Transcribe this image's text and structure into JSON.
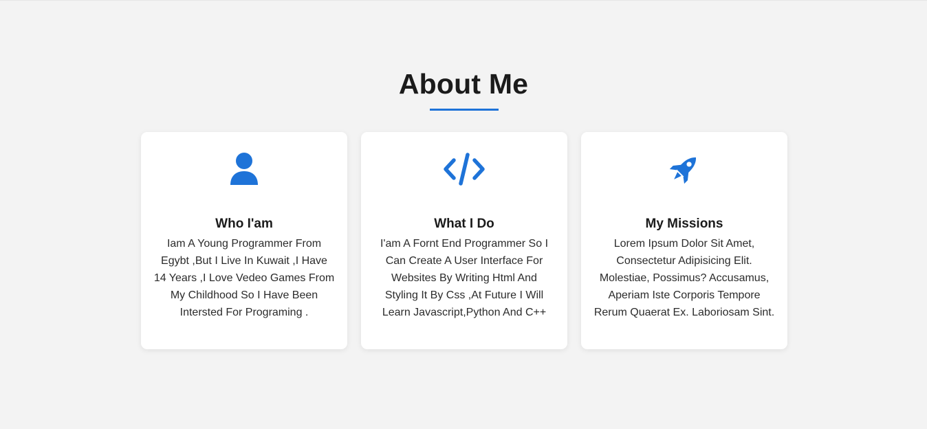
{
  "section": {
    "title": "About Me",
    "accent_color": "#1e73d8"
  },
  "cards": [
    {
      "icon": "user-icon",
      "title": "Who I'am",
      "text": "Iam A Young Programmer From Egybt ,But I Live In Kuwait ,I Have 14 Years ,I Love Vedeo Games From My Childhood So I Have Been Intersted For Programing ."
    },
    {
      "icon": "code-icon",
      "title": "What I Do",
      "text": "I'am A Fornt End Programmer So I Can Create A User Interface For Websites By Writing Html And Styling It By Css ,At Future I Will Learn Javascript,Python And C++"
    },
    {
      "icon": "rocket-icon",
      "title": "My Missions",
      "text": "Lorem Ipsum Dolor Sit Amet, Consectetur Adipisicing Elit. Molestiae, Possimus? Accusamus, Aperiam Iste Corporis Tempore Rerum Quaerat Ex. Laboriosam Sint."
    }
  ]
}
